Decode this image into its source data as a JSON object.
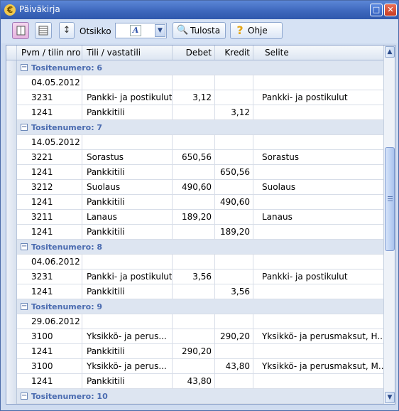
{
  "window": {
    "title": "Päiväkirja",
    "restore_glyph": "□",
    "close_glyph": "✕"
  },
  "toolbar": {
    "otsikko_label": "Otsikko",
    "otsikko_value_icon": "A",
    "print_label": "Tulosta",
    "help_label": "Ohje",
    "help_icon_glyph": "?"
  },
  "grid": {
    "columns": [
      "Pvm / tilin nro",
      "Tili / vastatili",
      "Debet",
      "Kredit",
      "Selite"
    ],
    "groups": [
      {
        "label": "Tositenumero: 6",
        "rows": [
          [
            "04.05.2012",
            "",
            "",
            "",
            ""
          ],
          [
            "3231",
            "Pankki- ja postikulut",
            "3,12",
            "",
            "Pankki- ja postikulut"
          ],
          [
            "1241",
            "Pankkitili",
            "",
            "3,12",
            ""
          ]
        ]
      },
      {
        "label": "Tositenumero: 7",
        "rows": [
          [
            "14.05.2012",
            "",
            "",
            "",
            ""
          ],
          [
            "3221",
            "Sorastus",
            "650,56",
            "",
            "Sorastus"
          ],
          [
            "1241",
            "Pankkitili",
            "",
            "650,56",
            ""
          ],
          [
            "3212",
            "Suolaus",
            "490,60",
            "",
            "Suolaus"
          ],
          [
            "1241",
            "Pankkitili",
            "",
            "490,60",
            ""
          ],
          [
            "3211",
            "Lanaus",
            "189,20",
            "",
            "Lanaus"
          ],
          [
            "1241",
            "Pankkitili",
            "",
            "189,20",
            ""
          ]
        ]
      },
      {
        "label": "Tositenumero: 8",
        "rows": [
          [
            "04.06.2012",
            "",
            "",
            "",
            ""
          ],
          [
            "3231",
            "Pankki- ja postikulut",
            "3,56",
            "",
            "Pankki- ja postikulut"
          ],
          [
            "1241",
            "Pankkitili",
            "",
            "3,56",
            ""
          ]
        ]
      },
      {
        "label": "Tositenumero: 9",
        "rows": [
          [
            "29.06.2012",
            "",
            "",
            "",
            ""
          ],
          [
            "3100",
            "Yksikkö- ja perus...",
            "",
            "290,20",
            "Yksikkö- ja perusmaksut, H..."
          ],
          [
            "1241",
            "Pankkitili",
            "290,20",
            "",
            ""
          ],
          [
            "3100",
            "Yksikkö- ja perus...",
            "",
            "43,80",
            "Yksikkö- ja perusmaksut, M..."
          ],
          [
            "1241",
            "Pankkitili",
            "43,80",
            "",
            ""
          ]
        ]
      },
      {
        "label": "Tositenumero: 10",
        "rows": []
      }
    ]
  }
}
